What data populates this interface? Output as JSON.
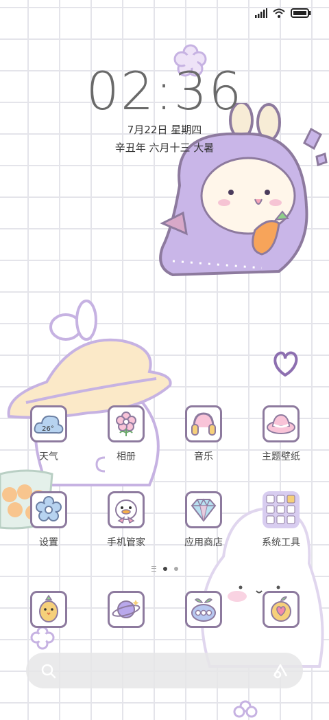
{
  "status_bar": {
    "signal_icon": "signal-bars-icon",
    "wifi_icon": "wifi-icon",
    "battery_icon": "battery-icon"
  },
  "lockclock": {
    "time": "02:36",
    "date": "7月22日 星期四",
    "lunar": "辛丑年 六月十三 大暑"
  },
  "apps": [
    {
      "label": "天气",
      "icon": "weather-cloud-icon",
      "temp": "26°"
    },
    {
      "label": "相册",
      "icon": "flower-icon"
    },
    {
      "label": "音乐",
      "icon": "headphones-icon"
    },
    {
      "label": "主题壁纸",
      "icon": "sun-hat-icon"
    },
    {
      "label": "设置",
      "icon": "gear-flower-icon"
    },
    {
      "label": "手机管家",
      "icon": "duck-icon"
    },
    {
      "label": "应用商店",
      "icon": "diamond-icon"
    },
    {
      "label": "系统工具",
      "icon": "folder-grid-icon"
    }
  ],
  "page_indicator": {
    "pages": 2,
    "current": 1
  },
  "dock": [
    {
      "icon": "chick-icon"
    },
    {
      "icon": "planet-icon"
    },
    {
      "icon": "sprout-phone-icon"
    },
    {
      "icon": "heart-fruit-icon"
    }
  ],
  "search": {
    "search_icon": "search-icon",
    "assistant_icon": "assistant-icon"
  },
  "colors": {
    "tile_border": "#8d7a9e",
    "grid": "#e4e4ea",
    "bunny_purple": "#c9b6e8",
    "hat": "#fbe9c8"
  }
}
